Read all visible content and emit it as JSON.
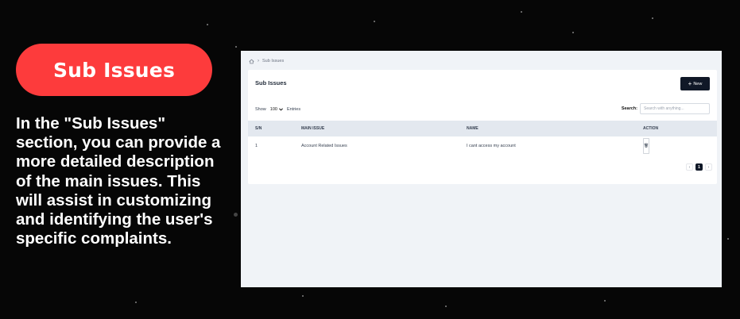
{
  "slide": {
    "title": "Sub Issues",
    "description": "In the \"Sub Issues\" section, you can provide a more detailed description of the main issues. This will assist in customizing and identifying the user's specific complaints."
  },
  "app": {
    "breadcrumb": {
      "current": "Sub Issues",
      "home_icon": "home-icon"
    },
    "card_title": "Sub Issues",
    "new_button": {
      "icon": "+",
      "label": "New"
    },
    "show": {
      "label": "Show",
      "value": "100",
      "suffix": "Entries"
    },
    "search": {
      "label": "Search:",
      "placeholder": "Search with anything..."
    },
    "table": {
      "columns": [
        "S/N",
        "MAIN ISSUE",
        "NAME",
        "ACTION"
      ],
      "rows": [
        {
          "sn": "1",
          "main_issue": "Account Related Issues",
          "name": "I cant access my account",
          "edit_icon": "✎",
          "delete_icon": "🗑"
        }
      ]
    },
    "pagination": {
      "prev": "‹",
      "current": "1",
      "next": "›"
    }
  },
  "colors": {
    "accent": "#fd3b3c",
    "dark": "#101827",
    "background": "#060606"
  }
}
